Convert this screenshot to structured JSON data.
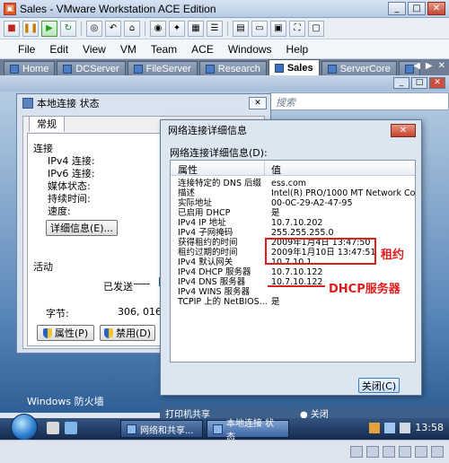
{
  "vmware": {
    "title": "Sales - VMware Workstation ACE Edition",
    "menu": [
      "File",
      "Edit",
      "View",
      "VM",
      "Team",
      "ACE",
      "Windows",
      "Help"
    ],
    "tabs": [
      {
        "label": "Home",
        "active": false
      },
      {
        "label": "DCServer",
        "active": false
      },
      {
        "label": "FileServer",
        "active": false
      },
      {
        "label": "Research",
        "active": false
      },
      {
        "label": "Sales",
        "active": true
      },
      {
        "label": "ServerCore",
        "active": false
      }
    ]
  },
  "guest": {
    "search_placeholder": "搜索",
    "firewall_label": "Windows 防火墙",
    "strip_left": "打印机共享",
    "strip_right": "● 关闭"
  },
  "status_window": {
    "title": "本地连接 状态",
    "tab": "常规",
    "connection_section": "连接",
    "fields": [
      "IPv4 连接:",
      "IPv6 连接:",
      "媒体状态:",
      "持续时间:",
      "速度:"
    ],
    "details_button": "详细信息(E)...",
    "activity_section": "活动",
    "sent_label": "已发送",
    "bytes_label": "字节:",
    "bytes_sent": "306, 016",
    "properties_button": "属性(P)",
    "disable_button": "禁用(D)"
  },
  "detail_window": {
    "title": "网络连接详细信息",
    "caption": "网络连接详细信息(D):",
    "col_property": "属性",
    "col_value": "值",
    "rows": [
      {
        "p": "连接特定的 DNS 后缀",
        "v": "ess.com"
      },
      {
        "p": "描述",
        "v": "Intel(R) PRO/1000 MT Network Conn"
      },
      {
        "p": "实际地址",
        "v": "00-0C-29-A2-47-95"
      },
      {
        "p": "已启用 DHCP",
        "v": "是"
      },
      {
        "p": "IPv4 IP 地址",
        "v": "10.7.10.202"
      },
      {
        "p": "IPv4 子网掩码",
        "v": "255.255.255.0"
      },
      {
        "p": "获得租约的时间",
        "v": "2009年1月4日 13:47:50"
      },
      {
        "p": "租约过期的时间",
        "v": "2009年1月10日 13:47:51"
      },
      {
        "p": "IPv4 默认网关",
        "v": "10.7.10.1"
      },
      {
        "p": "IPv4 DHCP 服务器",
        "v": "10.7.10.122"
      },
      {
        "p": "IPv4 DNS 服务器",
        "v": "10.7.10.122"
      },
      {
        "p": "IPv4 WINS 服务器",
        "v": ""
      },
      {
        "p": "TCPIP 上的 NetBIOS...",
        "v": "是"
      }
    ],
    "close_button": "关闭(C)"
  },
  "annotations": {
    "lease": "租约",
    "dhcp_server": "DHCP服务器",
    "color": "#e01d1d"
  },
  "taskbar": {
    "tasks": [
      {
        "label": "网络和共享...",
        "active": false
      },
      {
        "label": "本地连接 状态",
        "active": true
      }
    ],
    "time": "13:58"
  }
}
